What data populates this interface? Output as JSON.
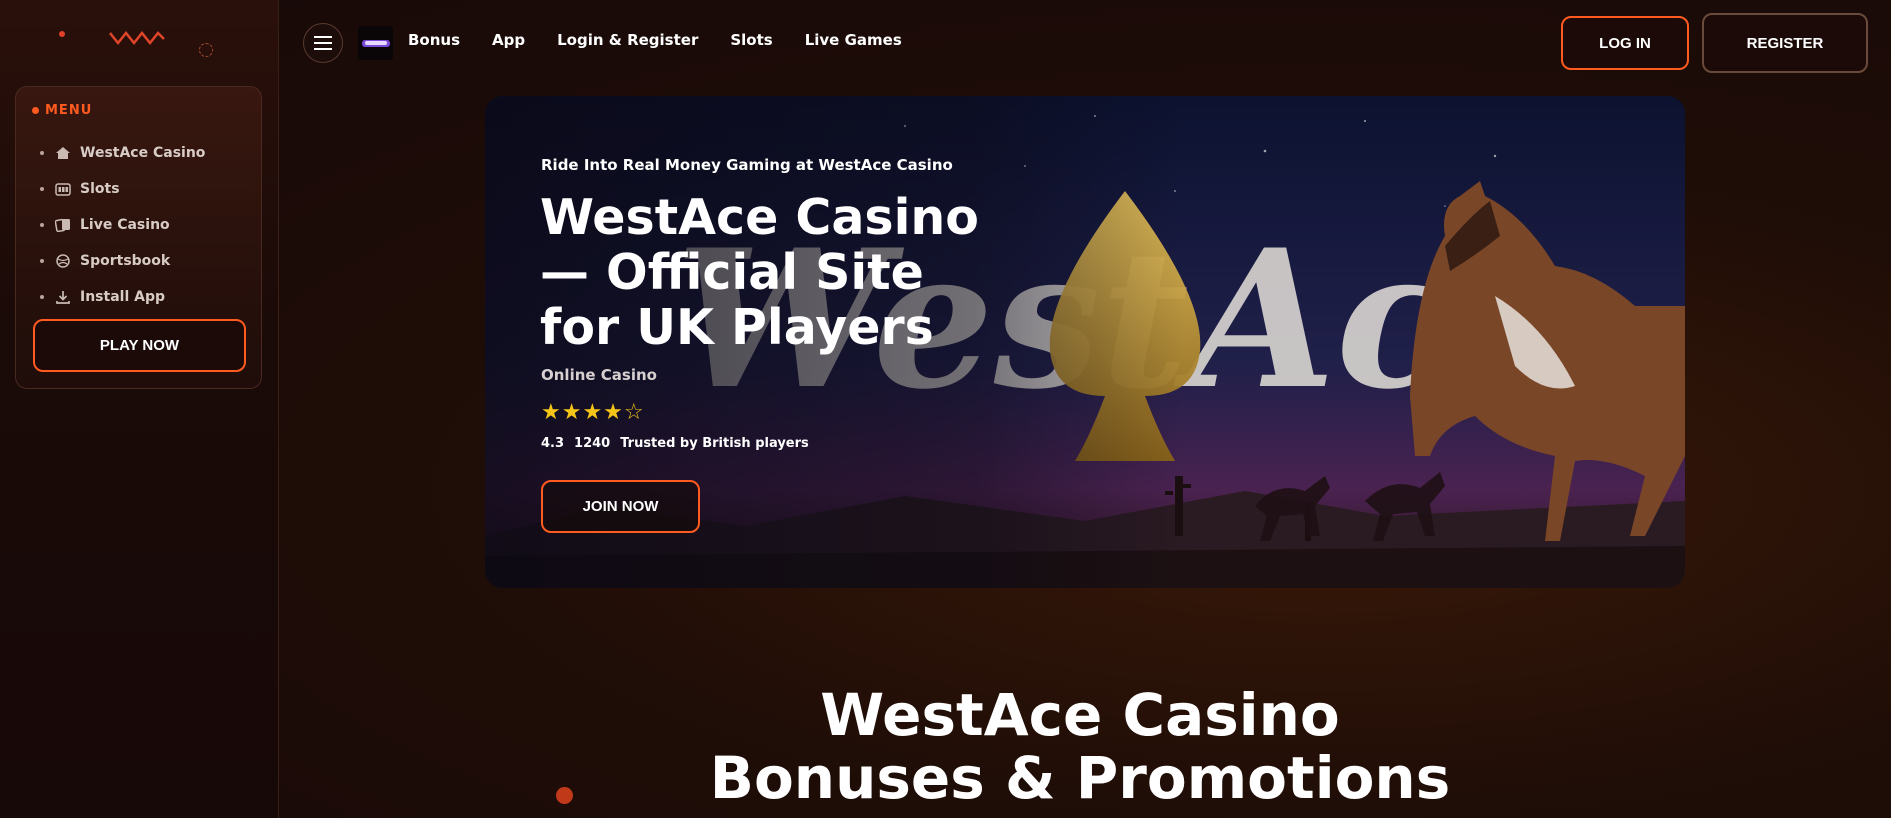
{
  "sidebar": {
    "menu_label": "MENU",
    "items": [
      {
        "label": "WestAce Casino",
        "icon": "home-icon"
      },
      {
        "label": "Slots",
        "icon": "slot-machine-icon"
      },
      {
        "label": "Live Casino",
        "icon": "cards-icon"
      },
      {
        "label": "Sportsbook",
        "icon": "ball-icon"
      },
      {
        "label": "Install App",
        "icon": "download-icon"
      }
    ],
    "play_label": "PLAY NOW"
  },
  "header": {
    "nav": [
      "Bonus",
      "App",
      "Login & Register",
      "Slots",
      "Live Games"
    ],
    "login_label": "LOG IN",
    "register_label": "REGISTER"
  },
  "hero": {
    "kicker": "Ride Into Real Money Gaming at WestAce Casino",
    "title": "WestAce Casino — Official Site for UK Players",
    "subtitle": "Online Casino",
    "stars": "★★★★☆",
    "rating_value": "4.3",
    "rating_count": "1240",
    "rating_note": "Trusted by British players",
    "join_label": "JOIN NOW",
    "art_text": "WestAce"
  },
  "section": {
    "title_line1": "WestAce Casino",
    "title_line2": "Bonuses & Promotions"
  },
  "colors": {
    "accent": "#ff5a1f",
    "star": "#f5c518",
    "background": "#170908"
  }
}
